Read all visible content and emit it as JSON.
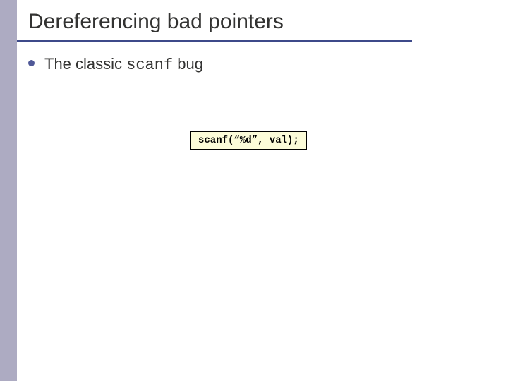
{
  "slide": {
    "title": "Dereferencing bad pointers",
    "bullet": {
      "prefix": "The classic ",
      "mono": "scanf",
      "suffix": " bug"
    },
    "code": "scanf(“%d”, val);"
  }
}
